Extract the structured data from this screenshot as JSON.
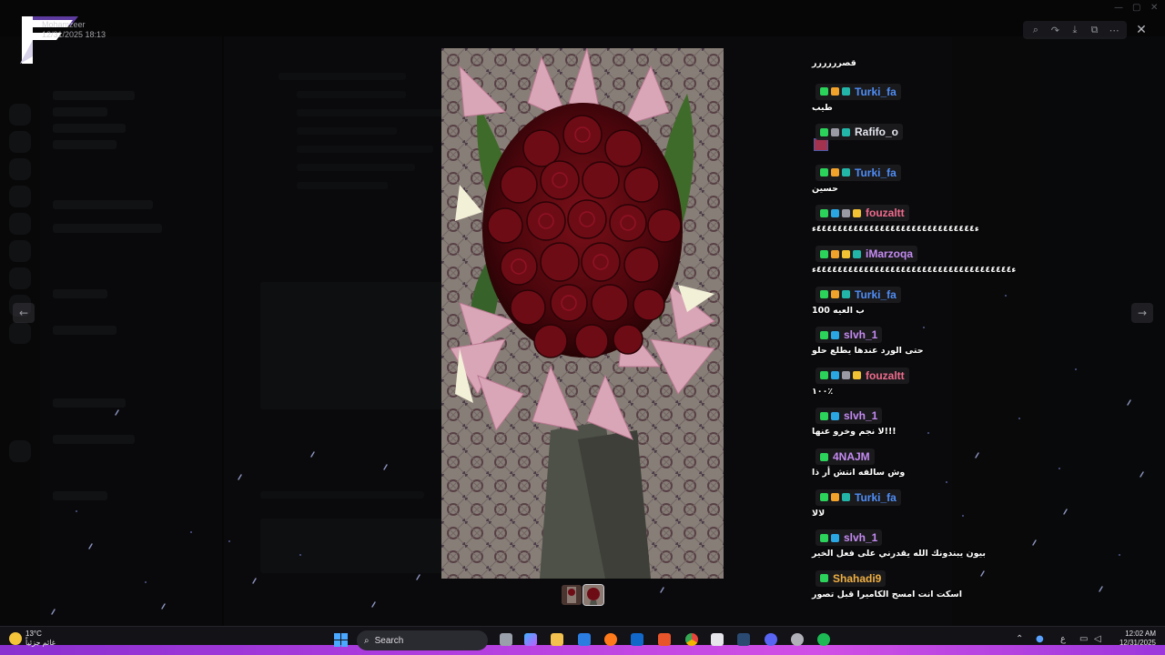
{
  "top": {
    "user_name": "Mohamzeer",
    "user_sub": "12/31/2025 18:13"
  },
  "viewer": {
    "toolbar": {
      "zoom_icon": "zoom-icon",
      "share_icon": "share-icon",
      "download_icon": "download-icon",
      "open_icon": "open-external-icon",
      "more_icon": "more-icon"
    },
    "close_icon": "close-icon",
    "prev_icon": "arrow-left-icon",
    "next_icon": "arrow-right-icon"
  },
  "chat": {
    "messages": [
      {
        "text": "قصرررررر"
      },
      {
        "user": "Turki_fa",
        "color": "#4f8df5",
        "badges": [
          "#2bd35a",
          "#f1a22b",
          "#23b6a8"
        ],
        "text": "طيب"
      },
      {
        "user": "Rafifo_o",
        "color": "#e5e7ef",
        "badges": [
          "#2bd35a",
          "#9a9aa5",
          "#23b6a8"
        ],
        "text": ""
      },
      {
        "user": "Turki_fa",
        "color": "#4f8df5",
        "badges": [
          "#2bd35a",
          "#f1a22b",
          "#23b6a8"
        ],
        "text": "حسين"
      },
      {
        "user": "fouzaltt",
        "color": "#f06b8c",
        "badges": [
          "#2bd35a",
          "#2aa7e3",
          "#9a9aa5",
          "#f1c233"
        ],
        "text": "ء٤٤٤٤٤٤٤٤٤٤٤٤٤٤٤٤٤٤٤٤٤٤٤٤٤٤٤٤٤٤ء"
      },
      {
        "user": "iMarzoqa",
        "color": "#c58bf2",
        "badges": [
          "#2bd35a",
          "#f1a22b",
          "#f1c233",
          "#23b6a8"
        ],
        "text": "ء٤٤٤٤٤٤٤٤٤٤٤٤٤٤٤٤٤٤٤٤٤٤٤٤٤٤٤٤٤٤٤٤٤٤٤٤٤ء"
      },
      {
        "user": "Turki_fa",
        "color": "#4f8df5",
        "badges": [
          "#2bd35a",
          "#f1a22b",
          "#23b6a8"
        ],
        "text": "ب العيه 100"
      },
      {
        "user": "slvh_1",
        "color": "#c58bf2",
        "badges": [
          "#2bd35a",
          "#2aa7e3"
        ],
        "text": "حتى الورد عندها يطلع حلو"
      },
      {
        "user": "fouzaltt",
        "color": "#f06b8c",
        "badges": [
          "#2bd35a",
          "#2aa7e3",
          "#9a9aa5",
          "#f1c233"
        ],
        "text": "١٠٠٪"
      },
      {
        "user": "slvh_1",
        "color": "#c58bf2",
        "badges": [
          "#2bd35a",
          "#2aa7e3"
        ],
        "text": "لا نجم وخرو عنها!!!"
      },
      {
        "user": "4NAJM",
        "color": "#c58bf2",
        "badges": [
          "#2bd35a"
        ],
        "text": "وش سالفه انتش أر ذا"
      },
      {
        "user": "Turki_fa",
        "color": "#4f8df5",
        "badges": [
          "#2bd35a",
          "#f1a22b",
          "#23b6a8"
        ],
        "text": "لالا"
      },
      {
        "user": "slvh_1",
        "color": "#c58bf2",
        "badges": [
          "#2bd35a",
          "#2aa7e3"
        ],
        "text": "بيون يبندونك الله يقدرني على فعل الخير"
      },
      {
        "user": "Shahadi9",
        "color": "#f0b042",
        "badges": [
          "#2bd35a"
        ],
        "text": "اسكت انت امسح الكاميرا قبل تصور"
      }
    ]
  },
  "taskbar": {
    "temperature": "13°C",
    "weather_sub": "غائم جزئياً",
    "search_placeholder": "Search",
    "time": "12:02 AM",
    "date": "12/31/2025",
    "lang": "ع"
  }
}
